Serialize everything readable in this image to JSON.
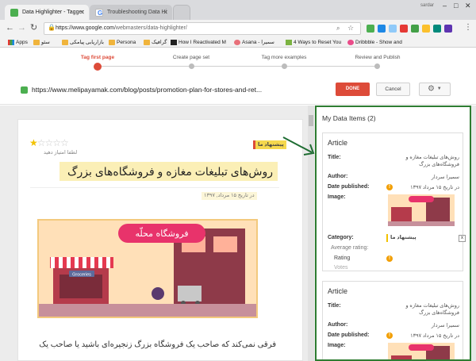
{
  "browser": {
    "tabs": [
      {
        "title": "Data Highlighter - Tagger",
        "active": true
      },
      {
        "title": "Troubleshooting Data Hi",
        "active": false
      }
    ],
    "username": "sardar",
    "url_prefix": "https://www.google.com",
    "url_path": "/webmasters/data-highlighter/",
    "bookmarks": [
      "Apps",
      "سئو",
      "بازاریابی پیامکی",
      "Persona",
      "گرافیک",
      "How I Reactivated M",
      "Asana - سمیرا",
      "4 Ways to Reset You",
      "Dribbble - Show and"
    ]
  },
  "wizard": {
    "steps": [
      "Tag first page",
      "Create page set",
      "Tag more examples",
      "Review and Publish"
    ],
    "active_index": 0,
    "accent": "#dd4b39"
  },
  "urlbar": {
    "page_url": "https://www.melipayamak.com/blog/posts/promotion-plan-for-stores-and-ret...",
    "done_label": "DONE",
    "cancel_label": "Cancel"
  },
  "article": {
    "rating_stars_filled": 1,
    "rating_stars_total": 5,
    "rate_prompt": "لطفا امتیاز دهید",
    "badge": "پیشنهاد ما",
    "title": "روش‌های تبلیغات مغازه و فروشگاه‌های بزرگ",
    "date": "در تاریخ ۱۵ مرداد, ۱۳۹۷",
    "hero_text": "فروشگاه محلّه",
    "hero_sign": "Groceries",
    "body": "فرقی نمی‌کند که صاحب یک فروشگاه بزرگ زنجیره‌ای باشید یا صاحب یک"
  },
  "panel": {
    "title": "My Data Items (2)",
    "border_color": "#2e7d32",
    "items": [
      {
        "heading": "Article",
        "title_label": "Title:",
        "title_value": "روش‌های تبلیغات مغازه و فروشگاه‌های بزرگ",
        "author_label": "Author:",
        "author_value": "سمیرا سردار",
        "date_label": "Date published:",
        "date_value": "در تاریخ ۱۵ مرداد ۱۳۹۷",
        "image_label": "Image:",
        "category_label": "Category:",
        "category_value": "پیشنهاد ما",
        "avg_label": "Average rating:",
        "rating_label": "Rating",
        "votes_label": "Votes"
      },
      {
        "heading": "Article",
        "title_label": "Title:",
        "title_value": "روش‌های تبلیغات مغازه و فروشگاه‌های بزرگ",
        "author_label": "Author:",
        "author_value": "سمیرا سردار",
        "date_label": "Date published:",
        "date_value": "در تاریخ ۱۵ مرداد ۱۳۹۷",
        "image_label": "Image:"
      }
    ]
  }
}
